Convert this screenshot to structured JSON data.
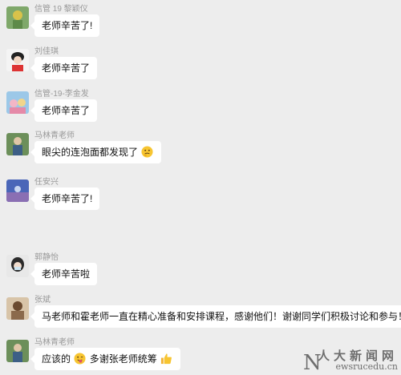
{
  "messages": [
    {
      "name": "信管 19 黎颖仪",
      "text": "老师辛苦了!"
    },
    {
      "name": "刘佳琪",
      "text": "老师辛苦了"
    },
    {
      "name": "信管-19-李金发",
      "text": "老师辛苦了"
    },
    {
      "name": "马林青老师",
      "text": "眼尖的连泡面都发现了",
      "emoji": "thinking-face"
    },
    {
      "name": "任安兴",
      "text": "老师辛苦了!"
    },
    {
      "name": "郭静怡",
      "text": "老师辛苦啦"
    },
    {
      "name": "张斌",
      "text": "马老师和霍老师一直在精心准备和安排课程，感谢他们！谢谢同学们积极讨论和参与！"
    },
    {
      "name": "马林青老师",
      "text_a": "应该的",
      "emoji_a": "tongue-wink-face",
      "text_b": "多谢张老师统筹",
      "emoji_b": "thumbs-up"
    }
  ],
  "watermark": {
    "letter": "N",
    "chinese": "人大新闻网",
    "url": "ewsrucedu.cn"
  }
}
